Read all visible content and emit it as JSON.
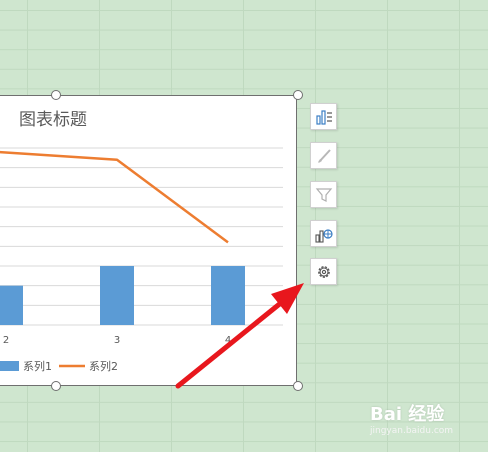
{
  "chart_data": {
    "type": "bar",
    "title": "图表标题",
    "categories": [
      "2",
      "3",
      "4"
    ],
    "series": [
      {
        "name": "系列1",
        "type": "bar",
        "color": "#5b9bd5",
        "values": [
          2,
          3,
          3
        ]
      },
      {
        "name": "系列2",
        "type": "line",
        "color": "#ed7d31",
        "values": [
          8.8,
          8.4,
          4.2
        ]
      }
    ],
    "ylim": [
      0,
      9
    ],
    "grid": true,
    "legend": "bottom"
  },
  "side_buttons": [
    {
      "icon": "chart-elements-icon"
    },
    {
      "icon": "chart-style-brush-icon"
    },
    {
      "icon": "chart-filter-icon"
    },
    {
      "icon": "chart-data-icon"
    },
    {
      "icon": "settings-gear-icon"
    }
  ],
  "annotation": {
    "color": "#e8171d"
  },
  "watermark": {
    "brand": "Bai 经验",
    "url": "jingyan.baidu.com"
  }
}
